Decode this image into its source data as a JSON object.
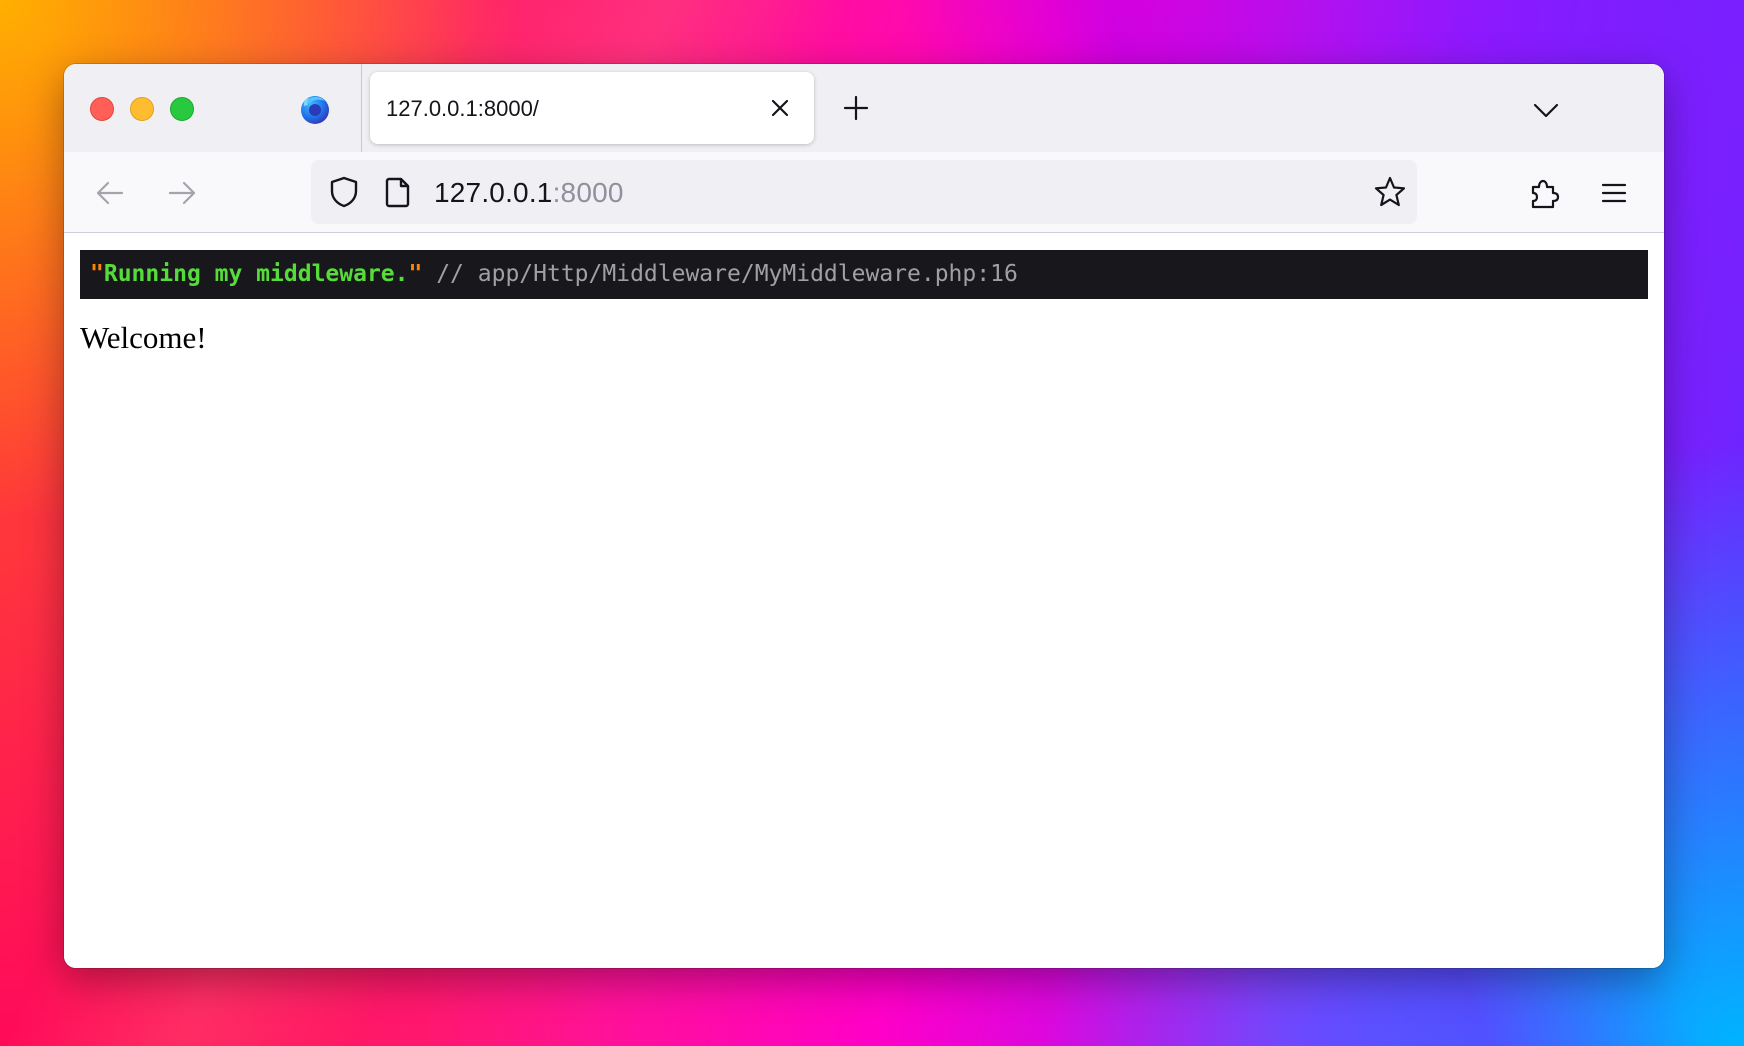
{
  "tab": {
    "title": "127.0.0.1:8000/"
  },
  "urlbar": {
    "host": "127.0.0.1",
    "port": ":8000"
  },
  "dump": {
    "open_quote": "\"",
    "string": "Running my middleware.",
    "close_quote": "\"",
    "source": " // app/Http/Middleware/MyMiddleware.php:16"
  },
  "page": {
    "welcome": "Welcome!"
  },
  "colors": {
    "traffic_close": "#ff5f57",
    "traffic_minimize": "#febc2e",
    "traffic_maximize": "#28c840",
    "dump_background": "#18171b",
    "dump_string": "#56db3a",
    "dump_quote": "#ff8400",
    "dump_source": "#a0a0a0"
  },
  "icons": {
    "browser_logo": "firefox-logo-icon",
    "tab_close": "close-icon",
    "new_tab": "plus-icon",
    "tab_list": "chevron-down-icon",
    "back": "arrow-left-icon",
    "forward": "arrow-right-icon",
    "tracking_protection": "shield-icon",
    "site_info": "page-icon",
    "bookmark": "star-icon",
    "extensions": "puzzle-icon",
    "app_menu": "hamburger-icon"
  }
}
